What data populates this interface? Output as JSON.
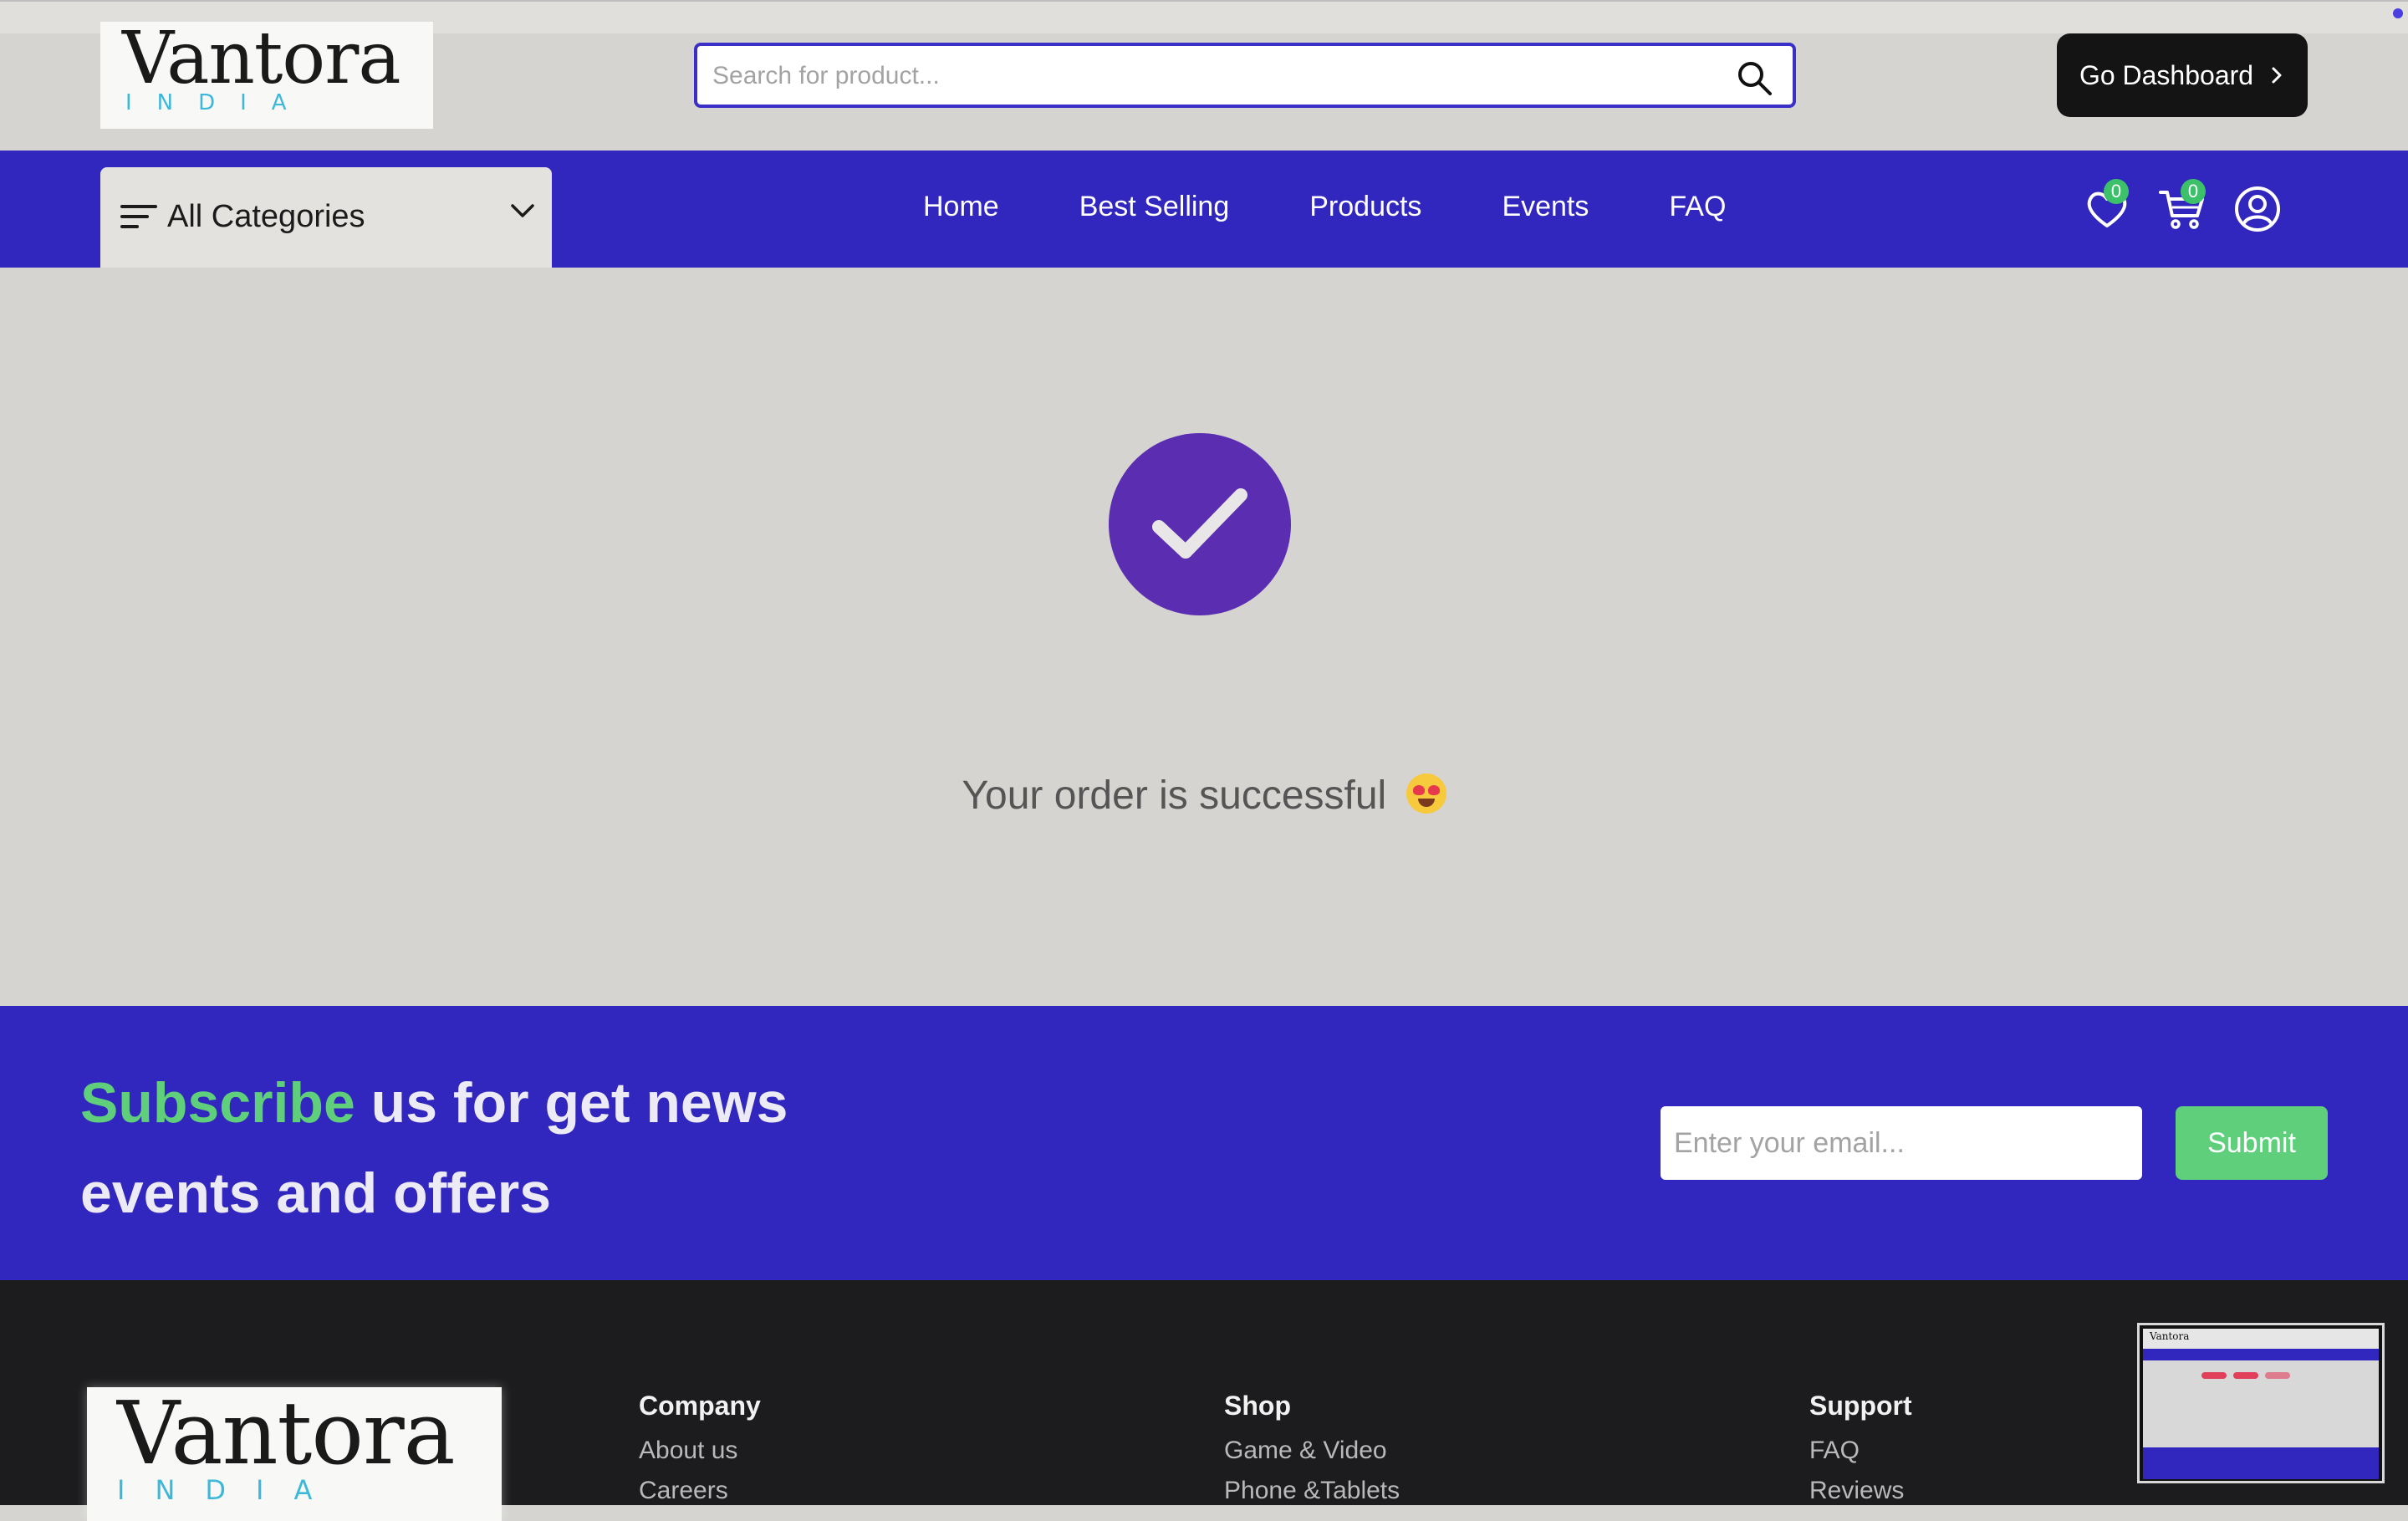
{
  "brand": {
    "name": "Vantora",
    "tagline": "INDIA"
  },
  "search": {
    "placeholder": "Search for product..."
  },
  "header": {
    "dashboard_label": "Go Dashboard"
  },
  "navbar": {
    "categories_label": "All Categories",
    "links": [
      "Home",
      "Best Selling",
      "Products",
      "Events",
      "FAQ"
    ],
    "wishlist_count": "0",
    "cart_count": "0"
  },
  "main": {
    "success_message": "Your order is successful"
  },
  "subscribe": {
    "highlight": "Subscribe",
    "rest": " us for get news events and offers",
    "email_placeholder": "Enter your email...",
    "submit_label": "Submit"
  },
  "footer": {
    "columns": [
      {
        "heading": "Company",
        "items": [
          "About us",
          "Careers"
        ]
      },
      {
        "heading": "Shop",
        "items": [
          "Game & Video",
          "Phone &Tablets"
        ]
      },
      {
        "heading": "Support",
        "items": [
          "FAQ",
          "Reviews"
        ]
      }
    ]
  },
  "colors": {
    "primary": "#3126bd",
    "accent_green": "#5fcf7b",
    "check_purple": "#5b2db0",
    "footer_bg": "#1c1c1e"
  }
}
